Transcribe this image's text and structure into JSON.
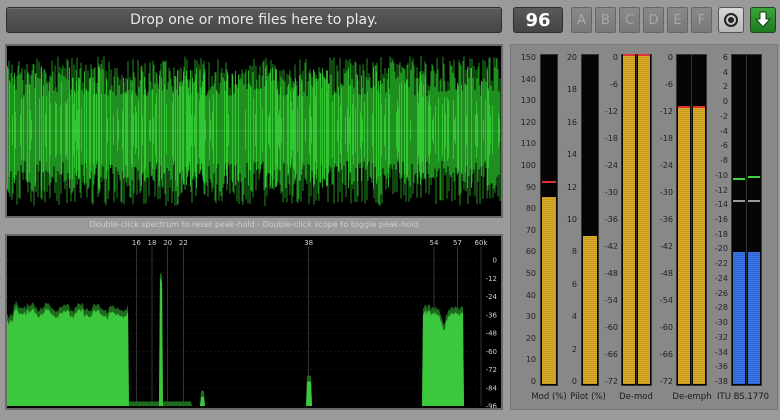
{
  "header": {
    "drop_text": "Drop one or more files here to play.",
    "volume": "96",
    "presets": [
      "A",
      "B",
      "C",
      "D",
      "E",
      "F"
    ]
  },
  "hint": "Double-click spectrum to reset peak-hold - Double-click scope to toggle peak-hold",
  "spectrum": {
    "freq_labels": [
      "16",
      "18",
      "20",
      "22",
      "38",
      "54",
      "57",
      "60k"
    ],
    "db_labels": [
      "0",
      "-12",
      "-24",
      "-36",
      "-48",
      "-60",
      "-72",
      "-84",
      "-96"
    ]
  },
  "meters": {
    "mod": {
      "label": "Mod (%)",
      "ticks": [
        "150",
        "140",
        "130",
        "120",
        "110",
        "100",
        "90",
        "80",
        "70",
        "60",
        "50",
        "40",
        "30",
        "20",
        "10",
        "0"
      ],
      "level_percent": 85,
      "peak_percent": 92
    },
    "pilot": {
      "label": "Pilot (%)",
      "ticks": [
        "20",
        "18",
        "16",
        "14",
        "12",
        "10",
        "8",
        "6",
        "4",
        "2",
        "0"
      ],
      "level_percent": 9
    },
    "demod": {
      "label": "De-mod",
      "ticks": [
        "0",
        "-6",
        "-12",
        "-18",
        "-24",
        "-30",
        "-36",
        "-42",
        "-48",
        "-54",
        "-60",
        "-66",
        "-72"
      ],
      "level_db_left": -0.5,
      "level_db_right": -0.5
    },
    "deemph": {
      "label": "De-emph",
      "ticks": [
        "0",
        "-6",
        "-12",
        "-18",
        "-24",
        "-30",
        "-36",
        "-42",
        "-48",
        "-54",
        "-60",
        "-66",
        "-72"
      ],
      "level_db_left": -12.5,
      "level_db_right": -12.5
    },
    "itu": {
      "label": "ITU BS.1770",
      "ticks": [
        "6",
        "4",
        "2",
        "0",
        "-2",
        "-4",
        "-6",
        "-8",
        "-10",
        "-12",
        "-14",
        "-16",
        "-18",
        "-20",
        "-22",
        "-24",
        "-26",
        "-28",
        "-30",
        "-32",
        "-34",
        "-36",
        "-38"
      ],
      "level_lufs": -21,
      "short_term_peak": -11,
      "target": -14
    }
  },
  "colors": {
    "scope_green": "#37d437",
    "spectrum_green": "#3cc83c",
    "meter_amber": "#d4a62a",
    "meter_blue": "#3670de",
    "peak_red": "#e03030"
  }
}
